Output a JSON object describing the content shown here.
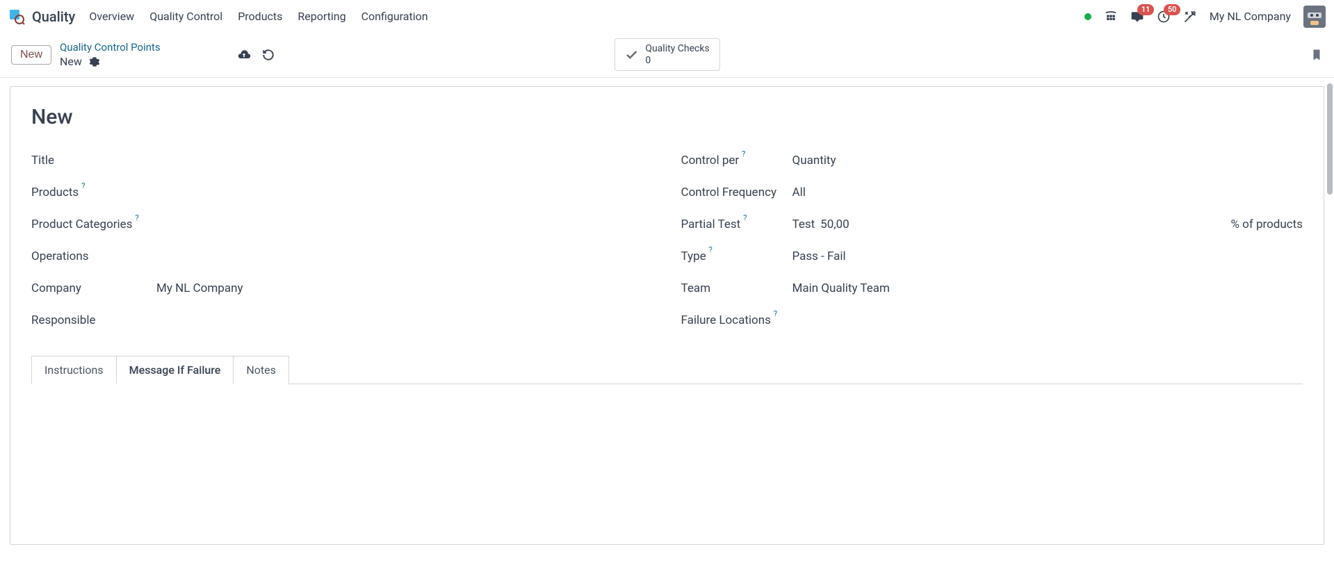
{
  "topbar": {
    "app_name": "Quality",
    "menu": [
      "Overview",
      "Quality Control",
      "Products",
      "Reporting",
      "Configuration"
    ],
    "messages_badge": "11",
    "activities_badge": "50",
    "company": "My NL Company"
  },
  "controlbar": {
    "new_button": "New",
    "breadcrumb_link": "Quality Control Points",
    "breadcrumb_current": "New",
    "statbox_label": "Quality Checks",
    "statbox_count": "0"
  },
  "record": {
    "title_display": "New",
    "left": {
      "title_label": "Title",
      "products_label": "Products",
      "product_categories_label": "Product Categories",
      "operations_label": "Operations",
      "company_label": "Company",
      "company_value": "My NL Company",
      "responsible_label": "Responsible"
    },
    "right": {
      "control_per_label": "Control per",
      "control_per_value": "Quantity",
      "control_frequency_label": "Control Frequency",
      "control_frequency_value": "All",
      "partial_test_label": "Partial Test",
      "partial_test_prefix": "Test",
      "partial_test_value": "50,00",
      "partial_test_suffix": "% of products",
      "type_label": "Type",
      "type_value": "Pass - Fail",
      "team_label": "Team",
      "team_value": "Main Quality Team",
      "failure_locations_label": "Failure Locations"
    }
  },
  "tabs": {
    "instructions": "Instructions",
    "message_if_failure": "Message If Failure",
    "notes": "Notes"
  },
  "help_q": "?"
}
